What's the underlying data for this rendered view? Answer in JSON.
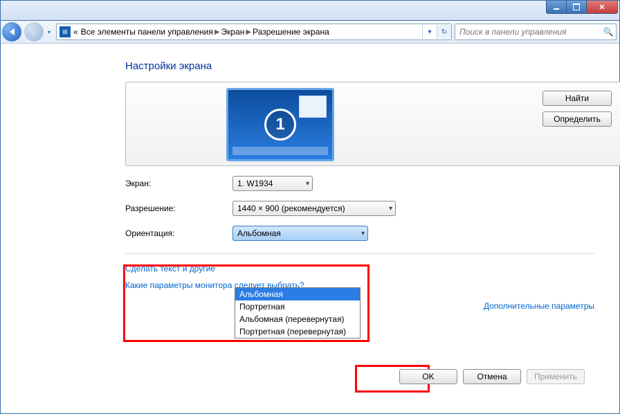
{
  "titlebar": {
    "min": "",
    "max": "",
    "close": "✕"
  },
  "nav": {
    "prefix": "«",
    "breadcrumb": [
      "Все элементы панели управления",
      "Экран",
      "Разрешение экрана"
    ],
    "search_placeholder": "Поиск в панели управления"
  },
  "page": {
    "heading": "Настройки экрана",
    "find": "Найти",
    "detect": "Определить",
    "fields": {
      "screen": {
        "label": "Экран:",
        "value": "1. W1934"
      },
      "resolution": {
        "label": "Разрешение:",
        "value": "1440 × 900 (рекомендуется)"
      },
      "orientation": {
        "label": "Ориентация:",
        "value": "Альбомная"
      }
    },
    "orientation_options": [
      "Альбомная",
      "Портретная",
      "Альбомная (перевернутая)",
      "Портретная (перевернутая)"
    ],
    "advanced": "Дополнительные параметры",
    "text_link": "Сделать текст и другие",
    "help_link": "Какие параметры монитора следует выбрать?",
    "ok": "OK",
    "cancel": "Отмена",
    "apply": "Применить"
  }
}
